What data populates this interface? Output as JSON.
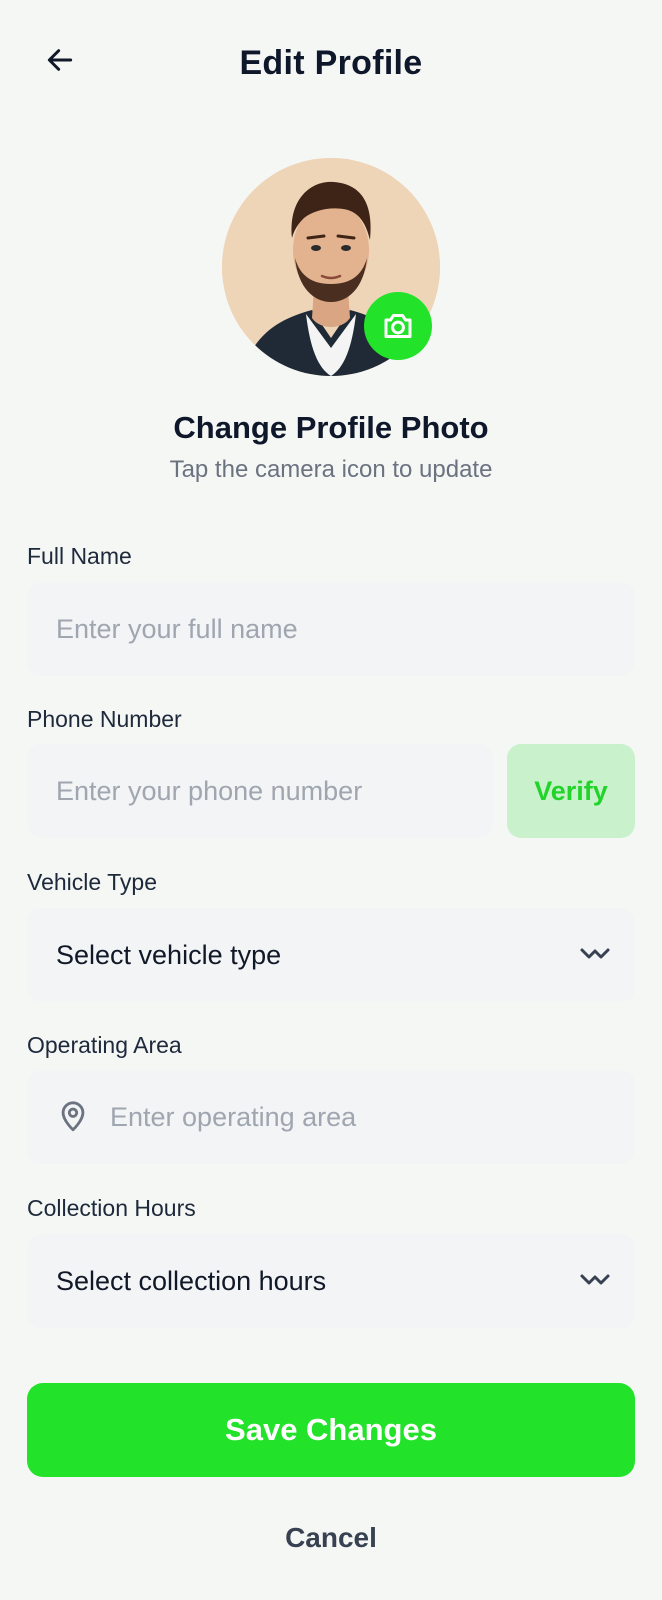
{
  "header": {
    "title": "Edit Profile",
    "back_icon": "arrow-left-icon"
  },
  "photo": {
    "title": "Change Profile Photo",
    "subtitle": "Tap the camera icon to update",
    "camera_icon": "camera-icon"
  },
  "form": {
    "full_name": {
      "label": "Full Name",
      "value": "",
      "placeholder": "Enter your full name"
    },
    "phone": {
      "label": "Phone Number",
      "value": "",
      "placeholder": "Enter your phone number",
      "verify_label": "Verify"
    },
    "vehicle_type": {
      "label": "Vehicle Type",
      "value": "Select vehicle type",
      "icon": "chevron-down-icon"
    },
    "operating_area": {
      "label": "Operating Area",
      "value": "",
      "placeholder": "Enter operating area",
      "icon": "location-pin-icon"
    },
    "collection_hours": {
      "label": "Collection Hours",
      "value": "Select collection hours",
      "icon": "chevron-down-icon"
    }
  },
  "actions": {
    "save_label": "Save Changes",
    "cancel_label": "Cancel"
  },
  "colors": {
    "accent": "#22e22a",
    "accent_light": "#c9f2cc",
    "background": "#f5f7f5",
    "field_bg": "#f2f4f6"
  }
}
